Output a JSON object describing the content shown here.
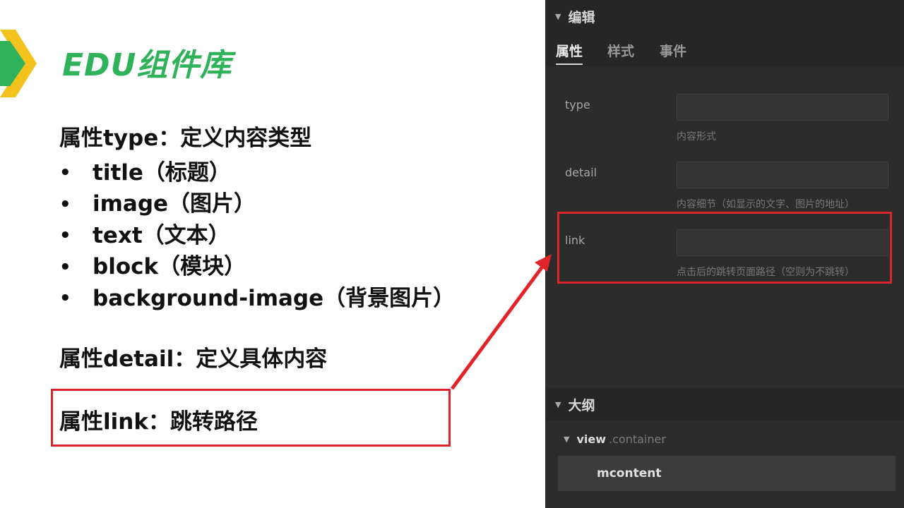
{
  "slide": {
    "title": "EDU组件库",
    "type_heading": "属性type：定义内容类型",
    "bullet_symbol": "•",
    "type_values": [
      "title（标题）",
      "image（图片）",
      "text（文本）",
      "block（模块）",
      "background-image（背景图片）"
    ],
    "detail_heading": "属性detail：定义具体内容",
    "link_heading": "属性link：跳转路径",
    "highlight_color": "#d8262a",
    "title_color": "#2fb25a"
  },
  "editor": {
    "edit_section_title": "编辑",
    "tabs": [
      "属性",
      "样式",
      "事件"
    ],
    "active_tab": "属性",
    "fields": [
      {
        "label": "type",
        "value": "",
        "hint": "内容形式"
      },
      {
        "label": "detail",
        "value": "",
        "hint": "内容细节（如显示的文字、图片的地址）"
      },
      {
        "label": "link",
        "value": "",
        "hint": "点击后的跳转页面路径（空则为不跳转）"
      }
    ],
    "outline_section_title": "大纲",
    "outline": {
      "root_tag": "view",
      "root_class": ".container",
      "selected_child": "mcontent"
    }
  }
}
